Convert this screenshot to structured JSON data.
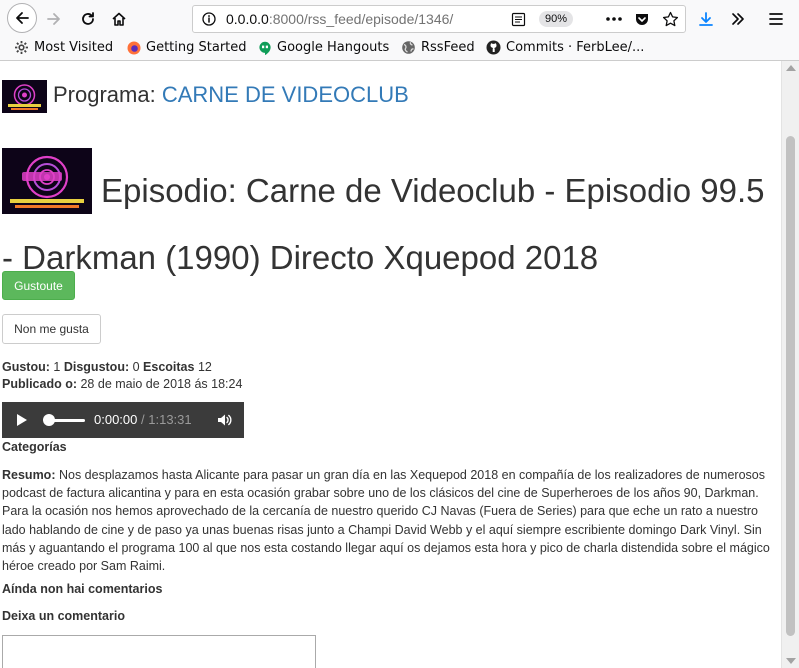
{
  "browser": {
    "url_host": "0.0.0.0",
    "url_path": ":8000/rss_feed/episode/1346/",
    "zoom": "90%",
    "bookmarks": [
      {
        "label": "Most Visited",
        "icon": "gear-icon"
      },
      {
        "label": "Getting Started",
        "icon": "firefox-icon"
      },
      {
        "label": "Google Hangouts",
        "icon": "hangouts-icon"
      },
      {
        "label": "RssFeed",
        "icon": "globe-icon"
      },
      {
        "label": "Commits · FerbLee/...",
        "icon": "github-icon"
      }
    ]
  },
  "program": {
    "label": "Programa:",
    "name": "CARNE DE VIDEOCLUB"
  },
  "episode": {
    "title": "Episodio: Carne de Videoclub - Episodio 99.5 - Darkman (1990) Directo Xquepod 2018"
  },
  "actions": {
    "like_label": "Gustoute",
    "dislike_label": "Non me gusta"
  },
  "stats": {
    "likes_label": "Gustou:",
    "likes": "1",
    "dislikes_label": "Disgustou:",
    "dislikes": "0",
    "plays_label": "Escoitas",
    "plays": "12",
    "published_label": "Publicado o:",
    "published": "28 de maio de 2018 ás 18:24"
  },
  "player": {
    "current": "0:00:00",
    "separator": "/",
    "duration": "1:13:31",
    "progress": 0
  },
  "categories_label": "Categorías",
  "summary": {
    "label": "Resumo:",
    "text": "Nos desplazamos hasta Alicante para pasar un gran día en las Xequepod 2018 en compañía de los realizadores de numerosos podcast de factura alicantina y para en esta ocasión grabar sobre uno de los clásicos del cine de Superheroes de los años 90, Darkman. Para la ocasión nos hemos aprovechado de la cercanía de nuestro querido CJ Navas (Fuera de Series) para que eche un rato a nuestro lado hablando de cine y de paso ya unas buenas risas junto a Champi David Webb y el aquí siempre escribiente domingo Dark Vinyl. Sin más y aguantando el programa 100 al que nos esta costando llegar aquí os dejamos esta hora y pico de charla distendida sobre el mágico héroe creado por Sam Raimi."
  },
  "comments": {
    "empty_label": "Aínda non hai comentarios",
    "leave_label": "Deixa un comentario",
    "input_value": ""
  },
  "colors": {
    "link": "#337ab7",
    "like_button": "#5cb85c",
    "player_bg": "#3b3b3b"
  }
}
